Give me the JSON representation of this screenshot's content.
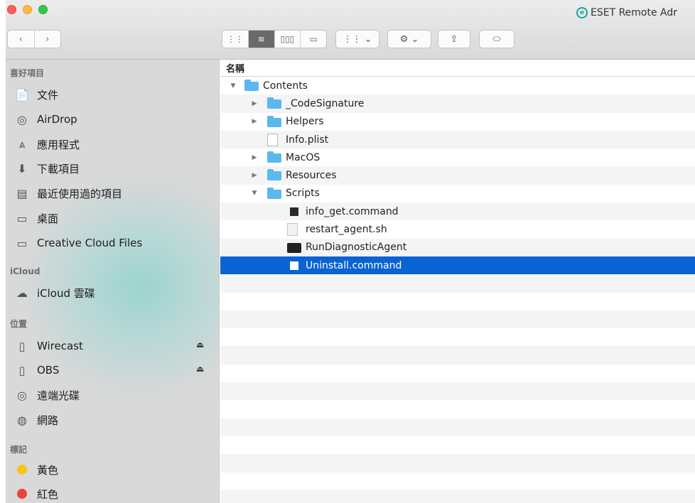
{
  "window": {
    "app_title": "ESET Remote Adr"
  },
  "toolbar": {
    "back_icon": "chevron-left-icon",
    "forward_icon": "chevron-right-icon",
    "views": [
      {
        "icon": "icon-view-icon",
        "glyph": "⋮⋮"
      },
      {
        "icon": "list-view-icon",
        "glyph": "≡",
        "active": true
      },
      {
        "icon": "column-view-icon",
        "glyph": "▯▯▯"
      },
      {
        "icon": "gallery-view-icon",
        "glyph": "▭"
      }
    ],
    "arrange_glyph": "⋮⋮ ⌄",
    "action_glyph": "⚙ ⌄",
    "share_glyph": "⇪",
    "tag_glyph": "⬭"
  },
  "sidebar": {
    "favorites_header": "喜好項目",
    "favorites": [
      {
        "label": "文件",
        "icon": "document-icon",
        "glyph": "📄"
      },
      {
        "label": "AirDrop",
        "icon": "airdrop-icon",
        "glyph": "◎"
      },
      {
        "label": "應用程式",
        "icon": "applications-icon",
        "glyph": "⩓"
      },
      {
        "label": "下載項目",
        "icon": "downloads-icon",
        "glyph": "⬇"
      },
      {
        "label": "最近使用過的項目",
        "icon": "recents-icon",
        "glyph": "▤"
      },
      {
        "label": "桌面",
        "icon": "desktop-icon",
        "glyph": "▭"
      },
      {
        "label": "Creative Cloud Files",
        "icon": "folder-icon",
        "glyph": "▭"
      }
    ],
    "icloud_header": "iCloud",
    "icloud": [
      {
        "label": "iCloud 雲碟",
        "icon": "cloud-icon",
        "glyph": "☁"
      }
    ],
    "locations_header": "位置",
    "locations": [
      {
        "label": "Wirecast",
        "icon": "disk-icon",
        "glyph": "▯",
        "eject": "⏏"
      },
      {
        "label": "OBS",
        "icon": "disk-icon",
        "glyph": "▯",
        "eject": "⏏"
      },
      {
        "label": "遠端光碟",
        "icon": "optical-disc-icon",
        "glyph": "◎"
      },
      {
        "label": "網路",
        "icon": "network-globe-icon",
        "glyph": "◍"
      }
    ],
    "tags_header": "標記",
    "tags": [
      {
        "label": "黃色",
        "color": "#f5c518"
      },
      {
        "label": "紅色",
        "color": "#e8423c"
      }
    ]
  },
  "filelist": {
    "column_name": "名稱",
    "rows": [
      {
        "name": "Contents",
        "kind": "folder",
        "level": 0,
        "disclosure": "▼"
      },
      {
        "name": "_CodeSignature",
        "kind": "folder",
        "level": 1,
        "disclosure": "▶"
      },
      {
        "name": "Helpers",
        "kind": "folder",
        "level": 1,
        "disclosure": "▶"
      },
      {
        "name": "Info.plist",
        "kind": "doc",
        "level": 1,
        "disclosure": ""
      },
      {
        "name": "MacOS",
        "kind": "folder",
        "level": 1,
        "disclosure": "▶"
      },
      {
        "name": "Resources",
        "kind": "folder",
        "level": 1,
        "disclosure": "▶"
      },
      {
        "name": "Scripts",
        "kind": "folder",
        "level": 1,
        "disclosure": "▼"
      },
      {
        "name": "info_get.command",
        "kind": "command",
        "level": 2,
        "disclosure": ""
      },
      {
        "name": "restart_agent.sh",
        "kind": "text",
        "level": 2,
        "disclosure": ""
      },
      {
        "name": "RunDiagnosticAgent",
        "kind": "terminal",
        "level": 2,
        "disclosure": ""
      },
      {
        "name": "Uninstall.command",
        "kind": "command",
        "level": 2,
        "disclosure": "",
        "selected": true
      }
    ],
    "selection_color": "#0a63d3"
  }
}
